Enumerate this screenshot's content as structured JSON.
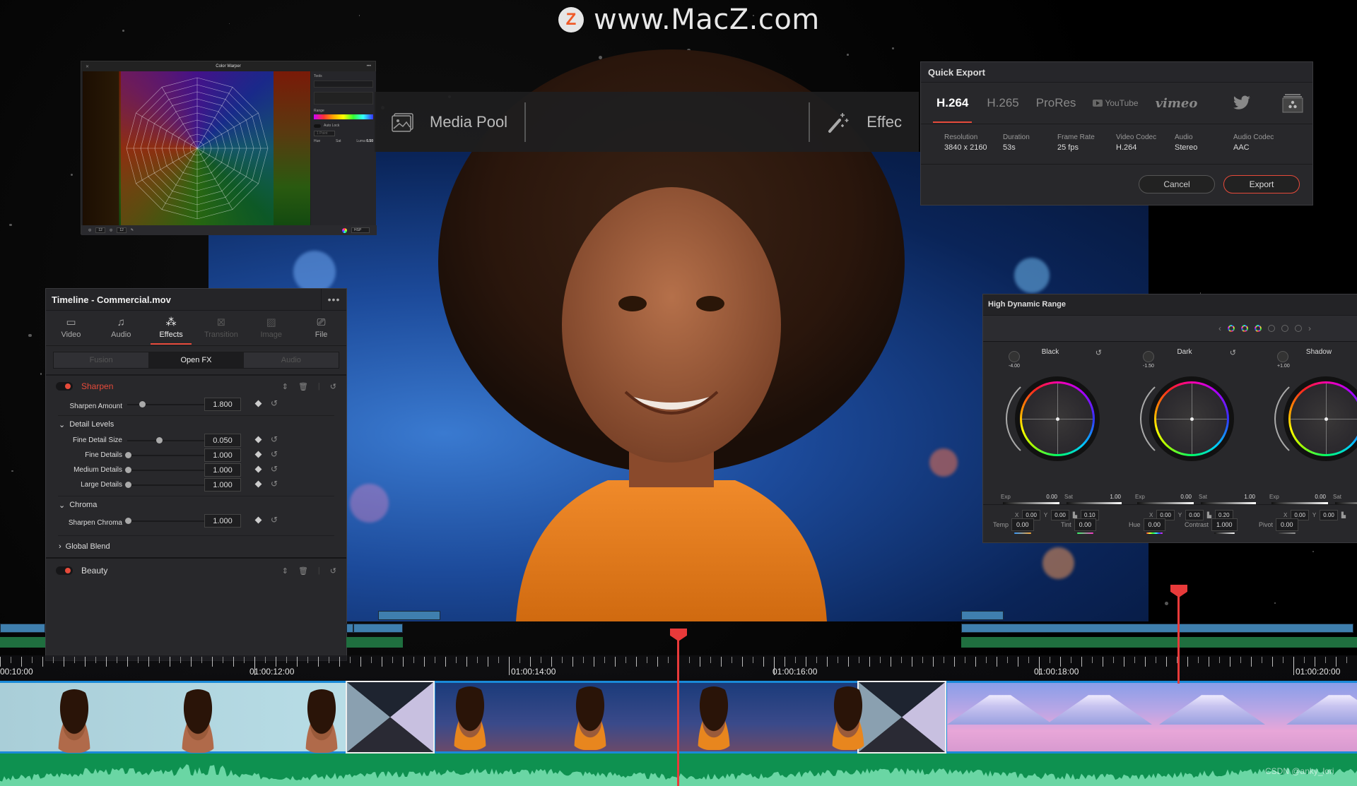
{
  "watermark": {
    "logo_letter": "Z",
    "text": "www.MacZ.com"
  },
  "toolbar": {
    "items": [
      {
        "icon": "image-icon",
        "label": "Media Pool"
      },
      {
        "icon": "effects-wand-icon",
        "label": "Effec"
      }
    ]
  },
  "color_warper": {
    "title": "Color Warper",
    "tools_label": "Tools",
    "range_label": "Range",
    "auto_lock_label": "Auto Lock",
    "points_select": "1 Point",
    "hue_label": "Hue",
    "sat_label": "Sat",
    "luma_label": "Luma",
    "luma_value": "0.50",
    "grid_a": "12",
    "grid_b": "12",
    "color_space": "HSP"
  },
  "quick_export": {
    "title": "Quick Export",
    "tabs": [
      {
        "label": "H.264",
        "active": true
      },
      {
        "label": "H.265",
        "active": false
      },
      {
        "label": "ProRes",
        "active": false
      },
      {
        "label": "YouTube",
        "active": false
      },
      {
        "label": "vimeo",
        "active": false
      },
      {
        "label": "twitter-icon",
        "active": false
      },
      {
        "label": "resolve-project-icon",
        "active": false
      }
    ],
    "info": [
      {
        "label": "Resolution",
        "value": "3840 x 2160"
      },
      {
        "label": "Duration",
        "value": "53s"
      },
      {
        "label": "Frame Rate",
        "value": "25 fps"
      },
      {
        "label": "Video Codec",
        "value": "H.264"
      },
      {
        "label": "Audio",
        "value": "Stereo"
      },
      {
        "label": "Audio Codec",
        "value": "AAC"
      }
    ],
    "cancel_label": "Cancel",
    "export_label": "Export",
    "accent": "#e64a3a"
  },
  "hdr": {
    "title": "High Dynamic Range",
    "wheels": [
      {
        "name": "Black",
        "zone_value": "-4.00",
        "exp": "0.00",
        "sat": "1.00",
        "x": "0.00",
        "y": "0.00",
        "falloff": "0.10"
      },
      {
        "name": "Dark",
        "zone_value": "-1.50",
        "exp": "0.00",
        "sat": "1.00",
        "x": "0.00",
        "y": "0.00",
        "falloff": "0.20"
      },
      {
        "name": "Shadow",
        "zone_value": "+1.00",
        "exp": "0.00",
        "sat": "",
        "x": "0.00",
        "y": "0.00",
        "falloff": ""
      }
    ],
    "exp_label": "Exp",
    "sat_label": "Sat",
    "x_label": "X",
    "y_label": "Y",
    "bottom": [
      {
        "label": "Temp",
        "value": "0.00"
      },
      {
        "label": "Tint",
        "value": "0.00"
      },
      {
        "label": "Hue",
        "value": "0.00"
      },
      {
        "label": "Contrast",
        "value": "1.000"
      },
      {
        "label": "Pivot",
        "value": "0.00"
      }
    ]
  },
  "timeline_panel": {
    "title": "Timeline - Commercial.mov",
    "more_label": "•••",
    "tabs": [
      {
        "label": "Video",
        "icon": "film-icon",
        "state": "normal"
      },
      {
        "label": "Audio",
        "icon": "music-note-icon",
        "state": "normal"
      },
      {
        "label": "Effects",
        "icon": "magic-wand-icon",
        "state": "active"
      },
      {
        "label": "Transition",
        "icon": "transition-icon",
        "state": "dim"
      },
      {
        "label": "Image",
        "icon": "image-icon",
        "state": "dim"
      },
      {
        "label": "File",
        "icon": "camera-icon",
        "state": "normal"
      }
    ],
    "segments": [
      {
        "label": "Fusion",
        "active": false
      },
      {
        "label": "Open FX",
        "active": true
      },
      {
        "label": "Audio",
        "active": false
      }
    ],
    "effects": [
      {
        "name": "Sharpen",
        "params": [
          {
            "label": "Sharpen Amount",
            "value": "1.800",
            "pos": 0.2
          }
        ]
      },
      {
        "name": "Beauty"
      }
    ],
    "detail_levels": {
      "label": "Detail Levels",
      "params": [
        {
          "label": "Fine Detail Size",
          "value": "0.050",
          "pos": 0.44
        },
        {
          "label": "Fine Details",
          "value": "1.000",
          "pos": 0
        },
        {
          "label": "Medium Details",
          "value": "1.000",
          "pos": 0
        },
        {
          "label": "Large Details",
          "value": "1.000",
          "pos": 0
        }
      ]
    },
    "chroma": {
      "label": "Chroma",
      "params": [
        {
          "label": "Sharpen Chroma",
          "value": "1.000",
          "pos": 0
        }
      ]
    },
    "global_blend_label": "Global Blend",
    "sharpen_color": "#e64a3a"
  },
  "timeline": {
    "timecodes": [
      "00:10:00",
      "01:00:12:00",
      "01:00:14:00",
      "01:00:16:00",
      "01:00:18:00",
      "01:00:20:00"
    ],
    "playhead_color": "#e83a3a",
    "clip_border": "#1a8ad8",
    "audio_color": "#0e9150"
  },
  "credit": "CSDN @anky_lori"
}
